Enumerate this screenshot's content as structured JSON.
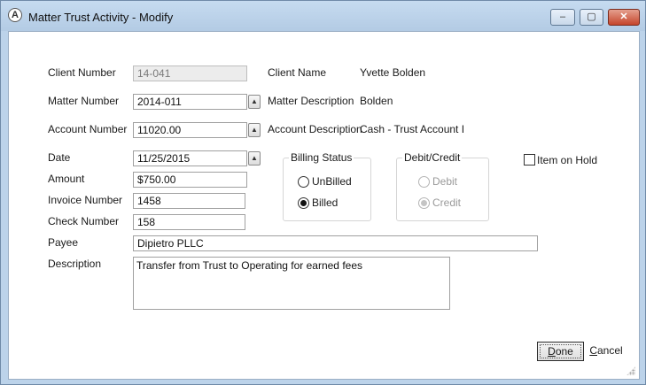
{
  "window": {
    "title": "Matter Trust Activity - Modify",
    "controls": {
      "minimize": "‒",
      "maximize": "▢",
      "close": "✕"
    }
  },
  "form": {
    "client_number": {
      "label": "Client Number",
      "value": "14-041"
    },
    "client_name": {
      "label": "Client Name",
      "value": "Yvette Bolden"
    },
    "matter_number": {
      "label": "Matter Number",
      "value": "2014-011"
    },
    "matter_description": {
      "label": "Matter Description",
      "value": "Bolden"
    },
    "account_number": {
      "label": "Account Number",
      "value": "11020.00"
    },
    "account_description": {
      "label": "Account Description",
      "value": "Cash - Trust Account I"
    },
    "date": {
      "label": "Date",
      "value": "11/25/2015"
    },
    "amount": {
      "label": "Amount",
      "value": "$750.00"
    },
    "invoice_number": {
      "label": "Invoice Number",
      "value": "1458"
    },
    "check_number": {
      "label": "Check Number",
      "value": "158"
    },
    "payee": {
      "label": "Payee",
      "value": "Dipietro PLLC"
    },
    "description": {
      "label": "Description",
      "value": "Transfer from Trust to Operating for earned fees"
    }
  },
  "billing_status": {
    "legend": "Billing Status",
    "options": [
      {
        "label": "UnBilled",
        "selected": false
      },
      {
        "label": "Billed",
        "selected": true
      }
    ]
  },
  "debit_credit": {
    "legend": "Debit/Credit",
    "disabled": true,
    "options": [
      {
        "label": "Debit",
        "selected": false
      },
      {
        "label": "Credit",
        "selected": true
      }
    ]
  },
  "item_on_hold": {
    "label": "Item on Hold",
    "checked": false
  },
  "buttons": {
    "done": {
      "first": "D",
      "rest": "one"
    },
    "cancel": {
      "first": "C",
      "rest": "ancel"
    }
  },
  "spin_glyph": "▲"
}
